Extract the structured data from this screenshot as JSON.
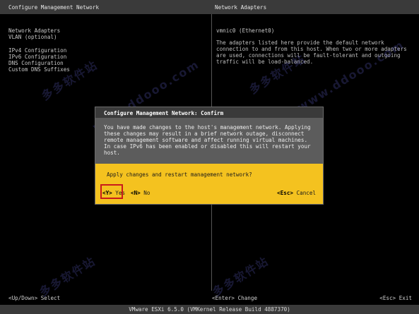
{
  "left_header": "Configure Management Network",
  "right_header": "Network Adapters",
  "menu": {
    "group1": [
      "Network Adapters",
      "VLAN (optional)"
    ],
    "group2": [
      "IPv4 Configuration",
      "IPv6 Configuration",
      "DNS Configuration",
      "Custom DNS Suffixes"
    ]
  },
  "adapter": {
    "name": "vmnic0 (Ethernet0)",
    "description": "The adapters listed here provide the default network connection to and from this host. When two or more adapters are used, connections will be fault-tolerant and outgoing traffic will be load-balanced."
  },
  "dialog": {
    "title": "Configure Management Network: Confirm",
    "message": "You have made changes to the host's management network. Applying these changes may result in a brief network outage, disconnect remote management software and affect running virtual machines. In case IPv6 has been enabled or disabled this will restart your host.",
    "question": "Apply changes and restart management network?",
    "yes_key": "<Y>",
    "yes_label": "Yes",
    "no_key": "<N>",
    "no_label": "No",
    "cancel_key": "<Esc>",
    "cancel_label": "Cancel"
  },
  "footer": {
    "select_key": "<Up/Down>",
    "select_label": "Select",
    "change_key": "<Enter>",
    "change_label": "Change",
    "exit_key": "<Esc>",
    "exit_label": "Exit"
  },
  "status": "VMware ESXi 6.5.0 (VMKernel Release Build 4887370)",
  "watermarks": [
    "多多软件站",
    "www.ddooo.com",
    "多多软件站",
    "www.ddooo.com",
    "多多软件站",
    "多多软件站"
  ],
  "colors": {
    "dialog_yellow": "#f4c21f",
    "highlight_red": "#c91b1b",
    "screen_black": "#000000"
  }
}
